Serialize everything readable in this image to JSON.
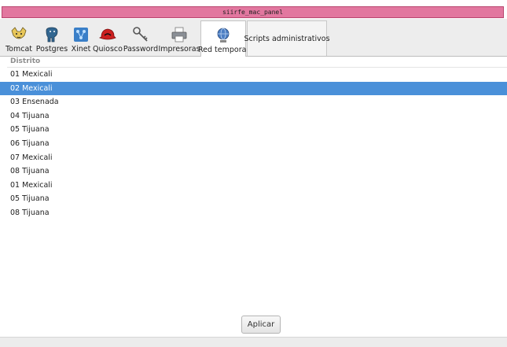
{
  "window": {
    "title": "siirfe_mac_panel"
  },
  "tabs": [
    {
      "label": "Tomcat",
      "icon": "tomcat-icon"
    },
    {
      "label": "Postgres",
      "icon": "postgres-elephant-icon"
    },
    {
      "label": "Xinet",
      "icon": "network-icon"
    },
    {
      "label": "Quiosco",
      "icon": "red-hat-icon"
    },
    {
      "label": "Password",
      "icon": "keys-icon"
    },
    {
      "label": "Impresoras",
      "icon": "printer-icon"
    },
    {
      "label": "Red temporal",
      "icon": "globe-network-icon",
      "active": true
    },
    {
      "label": "Scripts administrativos"
    }
  ],
  "list": {
    "header": "Distrito",
    "rows": [
      "01 Mexicali",
      "02 Mexicali",
      "03 Ensenada",
      "04 Tijuana",
      "05 Tijuana",
      "06 Tijuana",
      "07 Mexicali",
      "08 Tijuana",
      "01 Mexicali",
      "05 Tijuana",
      "08 Tijuana"
    ],
    "selected_index": 1
  },
  "actions": {
    "apply_label": "Aplicar"
  },
  "colors": {
    "titlebar": "#e2779f",
    "selection": "#4a90d9"
  }
}
